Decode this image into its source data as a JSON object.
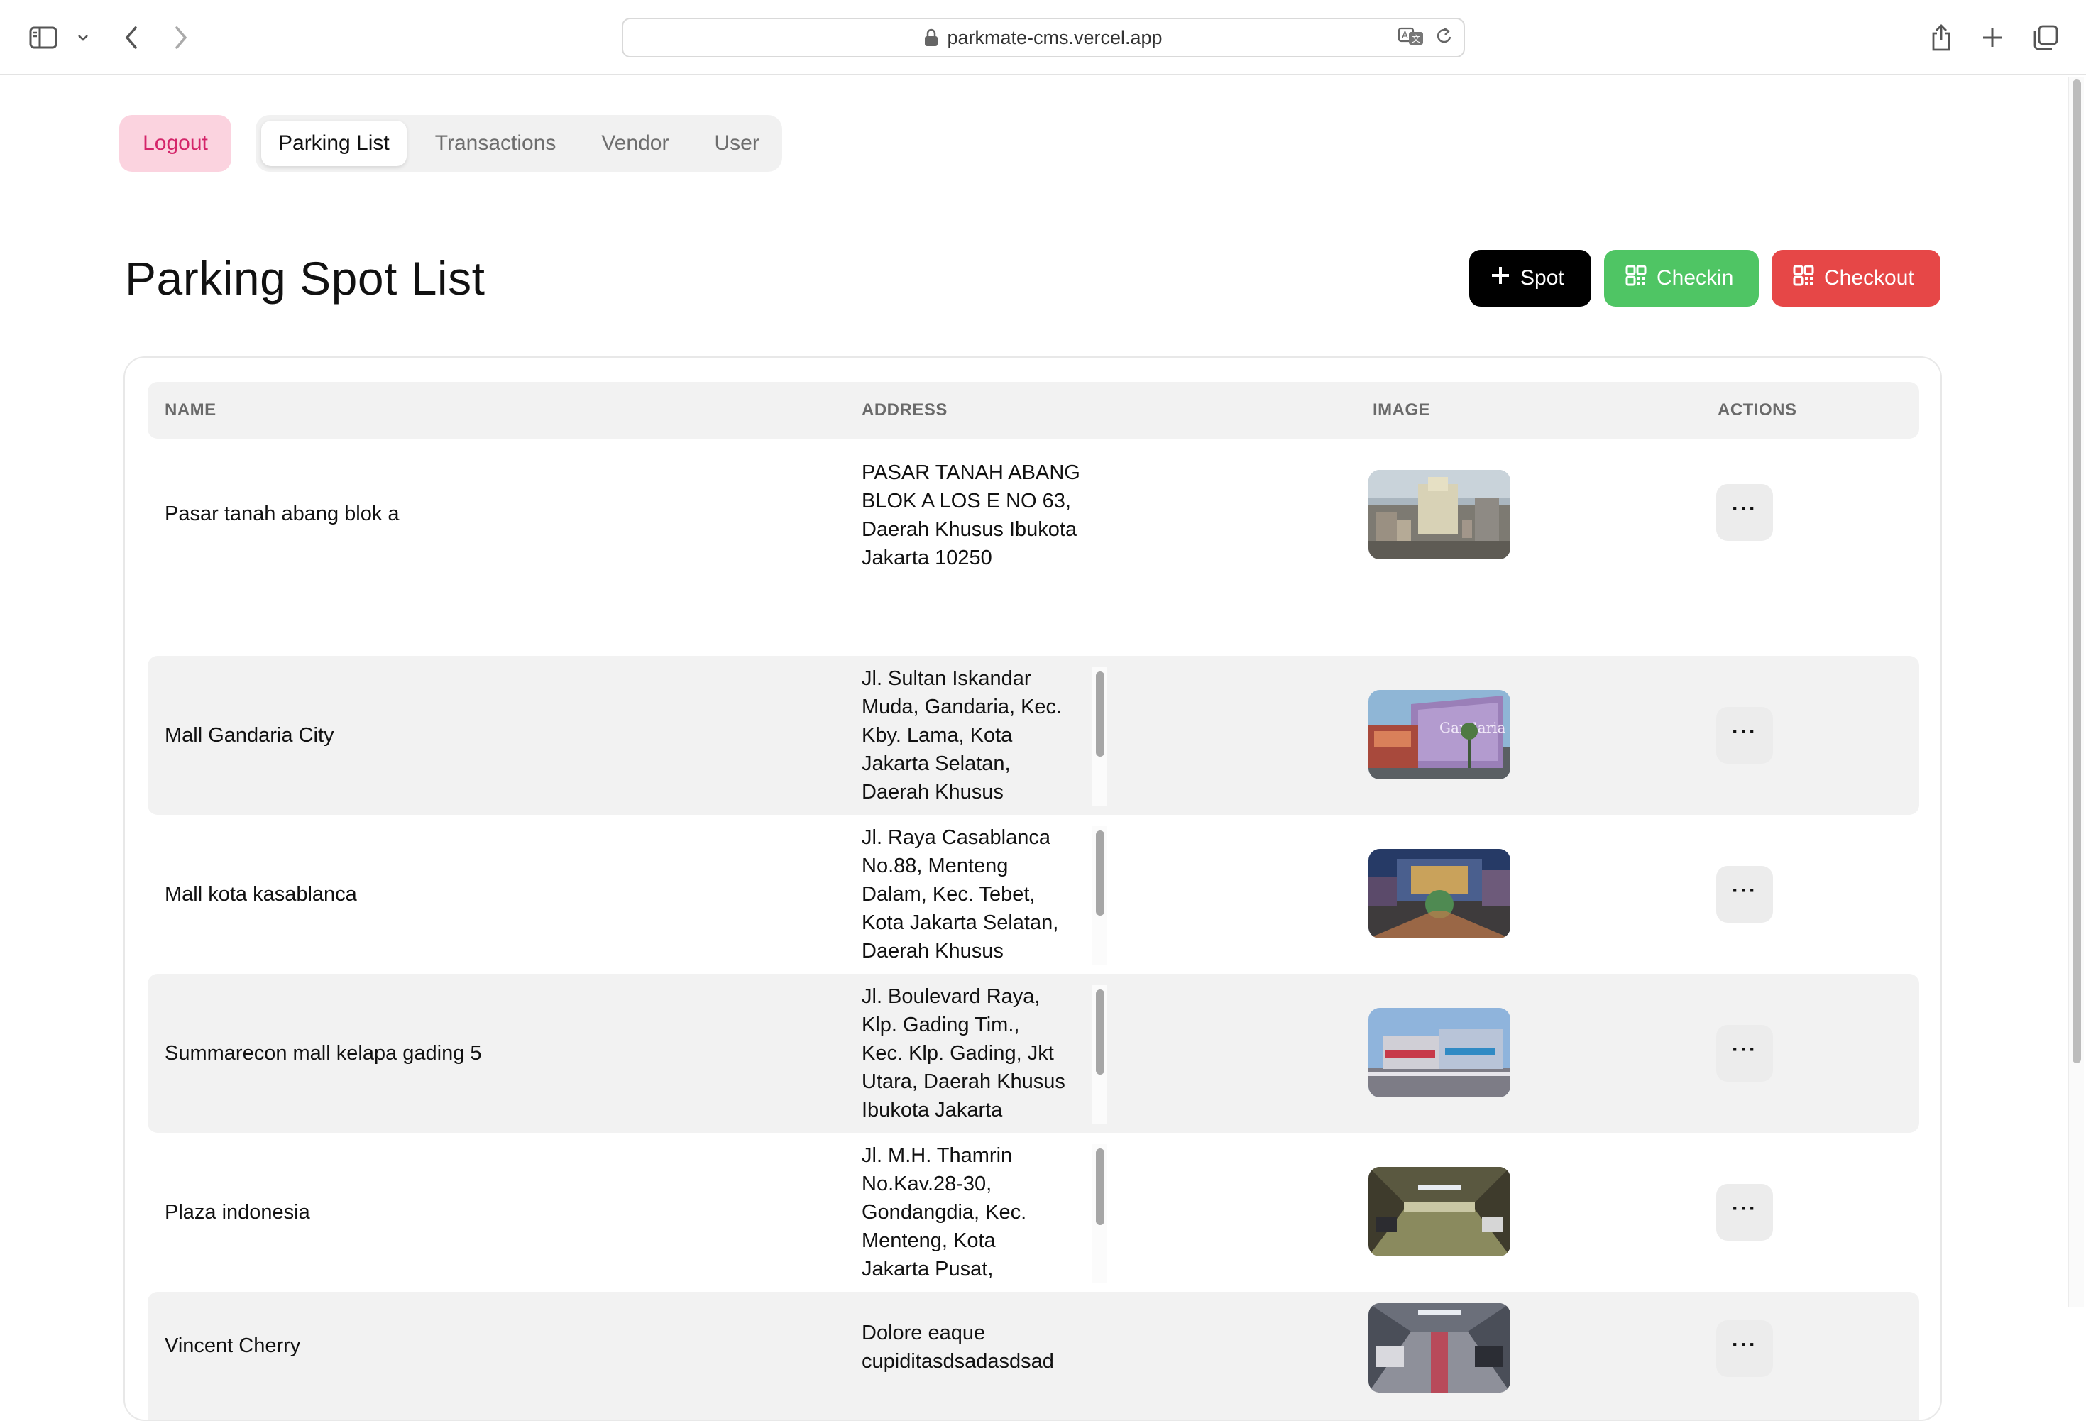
{
  "browser": {
    "url": "parkmate-cms.vercel.app"
  },
  "nav": {
    "logout_label": "Logout",
    "tabs": [
      {
        "label": "Parking List",
        "active": true
      },
      {
        "label": "Transactions",
        "active": false
      },
      {
        "label": "Vendor",
        "active": false
      },
      {
        "label": "User",
        "active": false
      }
    ]
  },
  "page": {
    "title": "Parking Spot List",
    "buttons": {
      "spot": "Spot",
      "checkin": "Checkin",
      "checkout": "Checkout"
    }
  },
  "table": {
    "headers": [
      "NAME",
      "ADDRESS",
      "IMAGE",
      "ACTIONS"
    ],
    "actions_label": "···",
    "rows": [
      {
        "name": "Pasar tanah abang blok a",
        "address": [
          "PASAR TANAH ABANG",
          "BLOK A LOS E NO 63,",
          "Daerah Khusus Ibukota",
          "Jakarta 10250"
        ],
        "image": "city-aerial-image"
      },
      {
        "name": "Mall Gandaria City",
        "address": [
          "Jl. Sultan Iskandar",
          "Muda, Gandaria, Kec.",
          "Kby. Lama, Kota",
          "Jakarta Selatan,",
          "Daerah Khusus"
        ],
        "image": "mall-facade-image"
      },
      {
        "name": "Mall kota kasablanca",
        "address": [
          "Jl. Raya Casablanca",
          "No.88, Menteng",
          "Dalam, Kec. Tebet,",
          "Kota Jakarta Selatan,",
          "Daerah Khusus"
        ],
        "image": "mall-night-image"
      },
      {
        "name": "Summarecon mall kelapa gading 5",
        "address": [
          "Jl. Boulevard Raya,",
          "Klp. Gading Tim.,",
          "Kec. Klp. Gading, Jkt",
          "Utara, Daerah Khusus",
          "Ibukota Jakarta"
        ],
        "image": "mall-street-image"
      },
      {
        "name": "Plaza indonesia",
        "address": [
          "Jl. M.H. Thamrin",
          "No.Kav.28-30,",
          "Gondangdia, Kec.",
          "Menteng, Kota",
          "Jakarta Pusat,"
        ],
        "image": "parking-garage-image"
      },
      {
        "name": "Vincent Cherry",
        "address": [
          "Dolore eaque",
          "cupiditasdsadasdsad"
        ],
        "image": "parking-lot-image"
      }
    ]
  }
}
